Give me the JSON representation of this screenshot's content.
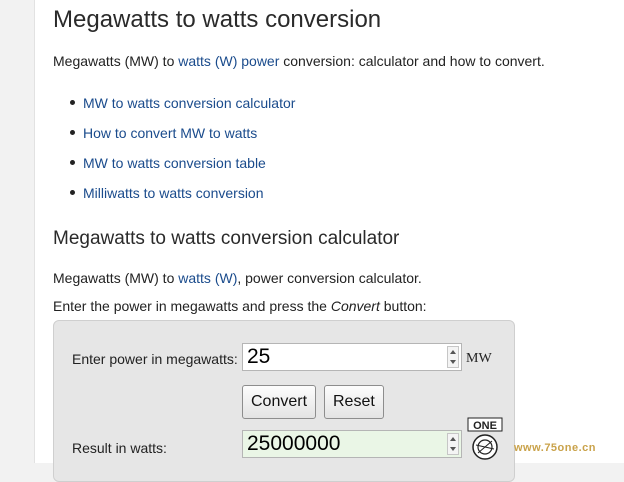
{
  "title": "Megawatts to watts conversion",
  "intro": {
    "prefix": "Megawatts (MW) to ",
    "link": "watts (W) power",
    "suffix": " conversion: calculator and how to convert."
  },
  "toc": [
    "MW to watts conversion calculator",
    "How to convert MW to watts",
    "MW to watts conversion table",
    "Milliwatts to watts conversion"
  ],
  "calculator_heading": "Megawatts to watts conversion calculator",
  "calc_intro": {
    "prefix": "Megawatts (MW) to ",
    "link": "watts (W)",
    "suffix": ", power conversion calculator."
  },
  "instruction": {
    "prefix": "Enter the power in megawatts and press the ",
    "emphasis": "Convert",
    "suffix": " button:"
  },
  "calculator": {
    "input_label": "Enter power in megawatts:",
    "input_value": "25",
    "unit": "MW",
    "convert_label": "Convert",
    "reset_label": "Reset",
    "result_label": "Result in watts:",
    "result_value": "25000000"
  },
  "watermark": {
    "logo_text": "ONE",
    "url_text": "www.75one.cn"
  }
}
